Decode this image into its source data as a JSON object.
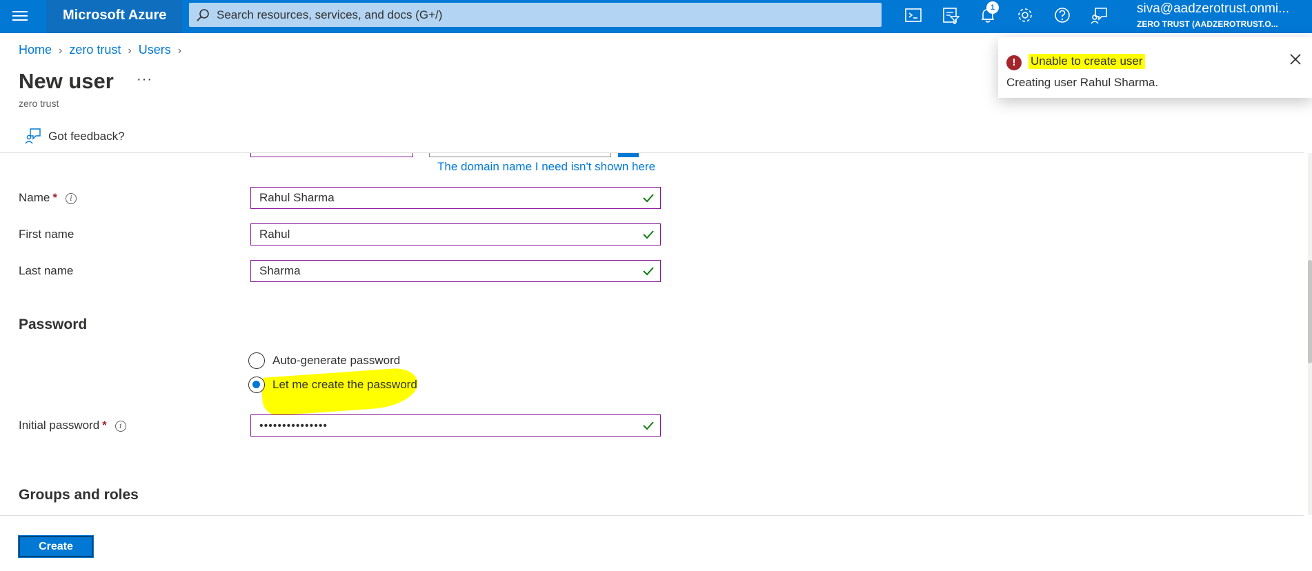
{
  "topbar": {
    "brand": "Microsoft Azure",
    "search_placeholder": "Search resources, services, and docs (G+/)",
    "notification_count": "1",
    "account_email": "siva@aadzerotrust.onmi...",
    "account_tenant": "ZERO TRUST (AADZEROTRUST.O..."
  },
  "breadcrumb": {
    "items": [
      "Home",
      "zero trust",
      "Users"
    ]
  },
  "page": {
    "title": "New user",
    "more": "···",
    "subtitle": "zero trust",
    "feedback": "Got feedback?"
  },
  "form": {
    "domain_link": "The domain name I need isn't shown here",
    "name": {
      "label": "Name",
      "value": "Rahul Sharma"
    },
    "first_name": {
      "label": "First name",
      "value": "Rahul"
    },
    "last_name": {
      "label": "Last name",
      "value": "Sharma"
    },
    "password_section": "Password",
    "radio_auto": "Auto-generate password",
    "radio_manual": "Let me create the password",
    "initial_password": {
      "label": "Initial password",
      "value": "•••••••••••••••"
    },
    "groups_section": "Groups and roles",
    "required_mark": "*",
    "info_glyph": "i"
  },
  "footer": {
    "create_label": "Create"
  },
  "toast": {
    "title": "Unable to create user",
    "message": "Creating user Rahul Sharma.",
    "error_glyph": "!"
  },
  "colors": {
    "azure_blue": "#0078d4",
    "field_border": "#881798",
    "error_red": "#a4262c",
    "highlight": "#ffff00",
    "check_green": "#107c10"
  }
}
